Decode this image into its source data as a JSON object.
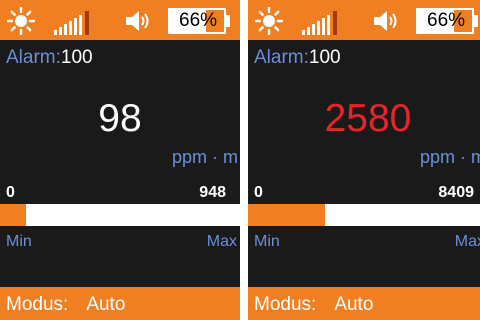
{
  "colors": {
    "frame": "#f07f22",
    "screen": "#1a1a1a",
    "accent_label": "#6b8fd6",
    "reading_normal": "#ffffff",
    "reading_alarm": "#e8242b",
    "signal_active": "#f07f22",
    "signal_peak": "#a33a12"
  },
  "devices": [
    {
      "status": {
        "battery_text": "66%",
        "battery_level": 0.66,
        "signal_bars": 6,
        "sun_icon": "sun-icon",
        "speaker_icon": "speaker-icon"
      },
      "alarm_label": "Alarm:",
      "alarm_value": "100",
      "reading": "98",
      "reading_alarm": false,
      "unit": "ppm · m",
      "scale_min": "0",
      "scale_max": "948",
      "bar_level": 0.11,
      "min_label": "Min",
      "max_label": "Max",
      "mode_label": "Modus:",
      "mode_value": "Auto"
    },
    {
      "status": {
        "battery_text": "66%",
        "battery_level": 0.66,
        "signal_bars": 6,
        "sun_icon": "sun-icon",
        "speaker_icon": "speaker-icon"
      },
      "alarm_label": "Alarm:",
      "alarm_value": "100",
      "reading": "2580",
      "reading_alarm": true,
      "unit": "ppm · m",
      "scale_min": "0",
      "scale_max": "8409",
      "bar_level": 0.32,
      "min_label": "Min",
      "max_label": "Max",
      "mode_label": "Modus:",
      "mode_value": "Auto"
    }
  ]
}
